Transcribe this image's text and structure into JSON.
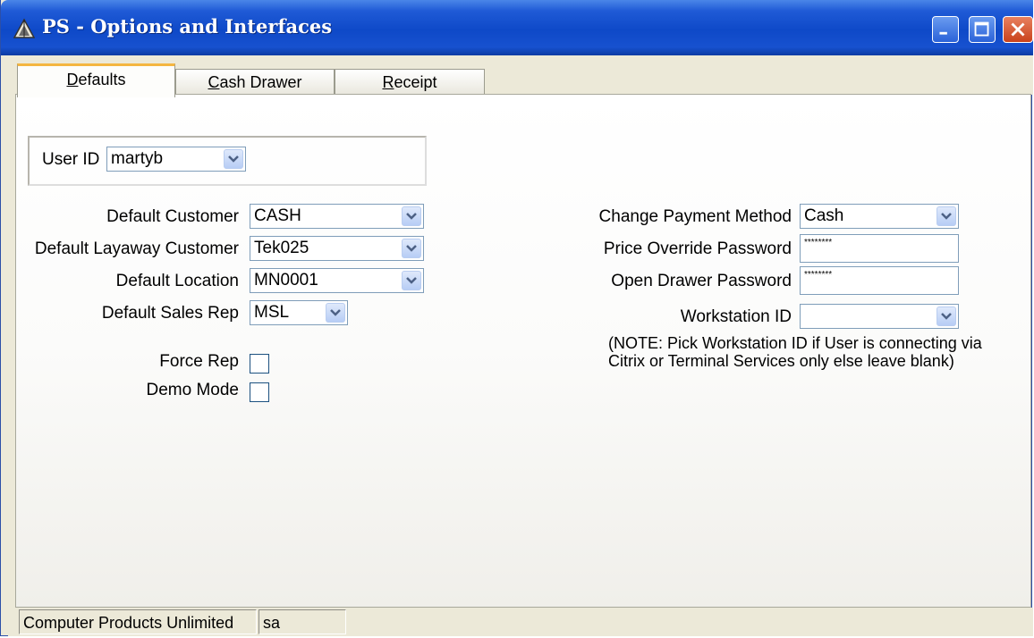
{
  "window": {
    "title": "PS - Options and Interfaces",
    "controls": {
      "minimize": "minimize",
      "maximize": "maximize",
      "close": "close"
    }
  },
  "tabs": [
    {
      "label": "Defaults",
      "mnemonic": "D",
      "rest": "efaults",
      "active": true
    },
    {
      "label": "Cash Drawer",
      "mnemonic": "C",
      "rest": "ash Drawer",
      "active": false
    },
    {
      "label": "Receipt",
      "mnemonic": "R",
      "rest": "eceipt",
      "active": false
    }
  ],
  "user": {
    "label": "User ID",
    "value": "martyb"
  },
  "left_fields": {
    "default_customer": {
      "label": "Default Customer",
      "value": "CASH"
    },
    "default_layaway_customer": {
      "label": "Default Layaway Customer",
      "value": "Tek025"
    },
    "default_location": {
      "label": "Default Location",
      "value": "MN0001"
    },
    "default_sales_rep": {
      "label": "Default Sales Rep",
      "value": "MSL"
    }
  },
  "checkboxes": {
    "force_rep": {
      "label": "Force Rep",
      "checked": false
    },
    "demo_mode": {
      "label": "Demo Mode",
      "checked": false
    }
  },
  "right_fields": {
    "change_payment_method": {
      "label": "Change Payment Method",
      "value": "Cash"
    },
    "price_override_password": {
      "label": "Price Override Password",
      "value": "********"
    },
    "open_drawer_password": {
      "label": "Open Drawer Password",
      "value": "********"
    },
    "workstation_id": {
      "label": "Workstation ID",
      "value": ""
    }
  },
  "note": "(NOTE: Pick Workstation ID if User is connecting via Citrix or Terminal Services only else leave blank)",
  "status": {
    "company": "Computer Products Unlimited",
    "user": "sa"
  },
  "colors": {
    "titlebar": "#0e49c8",
    "tab_highlight": "#f4b640",
    "field_border": "#7f9db9"
  }
}
